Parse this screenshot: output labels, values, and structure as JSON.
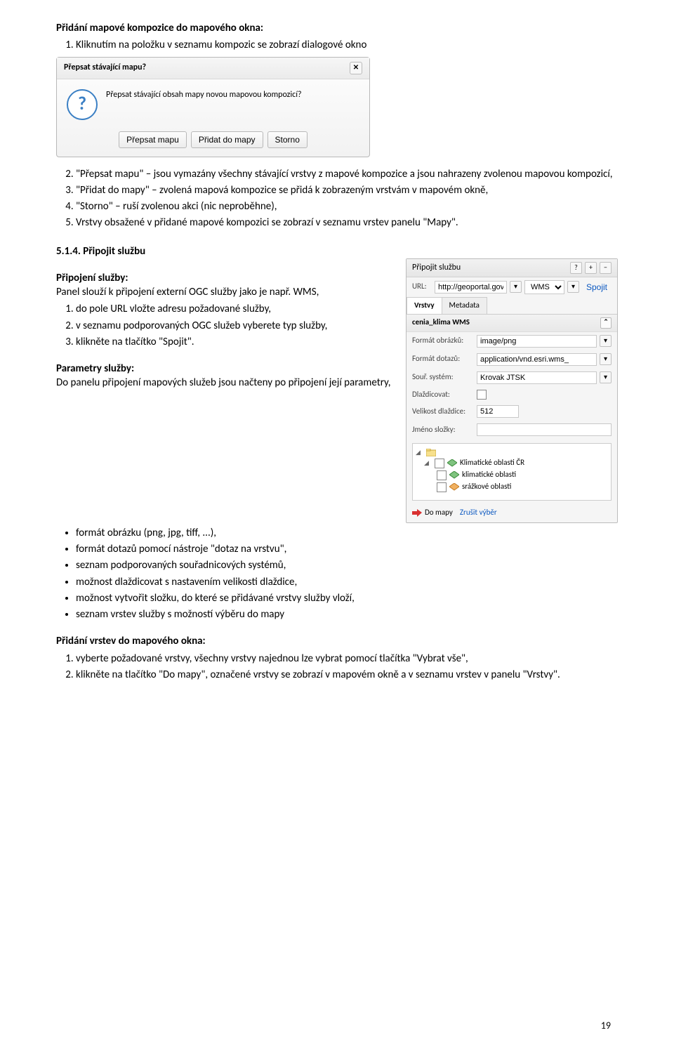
{
  "heading1": "Přidání mapové kompozice do mapového okna:",
  "list1": {
    "i1": "Kliknutím na položku v seznamu kompozic se zobrazí dialogové okno"
  },
  "dialog1": {
    "title": "Přepsat stávající mapu?",
    "question": "Přepsat stávající obsah mapy novou mapovou kompozicí?",
    "btn1": "Přepsat mapu",
    "btn2": "Přidat do mapy",
    "btn3": "Storno",
    "close": "✕"
  },
  "list2": {
    "i2": "\"Přepsat mapu\" – jsou vymazány všechny stávající vrstvy z mapové kompozice a jsou nahrazeny zvolenou mapovou kompozicí,",
    "i3": "\"Přidat do mapy\" – zvolená mapová kompozice se přidá k zobrazeným vrstvám v mapovém okně,",
    "i4": "\"Storno\" – ruší zvolenou akci (nic neproběhne),",
    "i5": "Vrstvy obsažené v přidané mapové kompozici se zobrazí v seznamu vrstev panelu \"Mapy\"."
  },
  "section514": {
    "title": "5.1.4. Připojit službu",
    "sub1": "Připojení služby:",
    "para1": "Panel slouží k připojení externí OGC služby jako je např. WMS,",
    "ol": {
      "a": "do pole URL vložte adresu požadované služby,",
      "b": "v seznamu podporovaných OGC služeb vyberete typ služby,",
      "c": "klikněte na tlačítko \"Spojit\"."
    },
    "sub2": "Parametry služby:",
    "para2": "Do panelu připojení mapových služeb jsou načteny po připojení její parametry,",
    "ul": {
      "a": "formát obrázku (png, jpg, tiff, ...),",
      "b": "formát dotazů pomocí nástroje \"dotaz na vrstvu\",",
      "c": "seznam podporovaných souřadnicových systémů,",
      "d": "možnost dlaždicovat s nastavením velikosti dlaždice,",
      "e": "možnost vytvořit složku, do které se přidávané vrstvy služby vloží,",
      "f": "seznam vrstev služby s možností výběru do mapy"
    }
  },
  "section_add": {
    "title": "Přidání vrstev do mapového okna:",
    "ol": {
      "a": "vyberte požadované vrstvy, všechny vrstvy najednou lze vybrat pomocí tlačítka \"Vybrat vše\",",
      "b": "klikněte na tlačítko \"Do mapy\", označené vrstvy se zobrazí v mapovém okně a v seznamu vrstev v panelu \"Vrstvy\"."
    }
  },
  "panel": {
    "title": "Připojit službu",
    "url_label": "URL:",
    "url_value": "http://geoportal.gov.cz/ArcGIS/s",
    "svc_type": "WMS",
    "connect": "Spojit",
    "tab_vrstvy": "Vrstvy",
    "tab_metadata": "Metadata",
    "service_name": "cenia_klima WMS",
    "rows": {
      "fmt_obr_l": "Formát obrázků:",
      "fmt_obr_v": "image/png",
      "fmt_dot_l": "Formát dotazů:",
      "fmt_dot_v": "application/vnd.esri.wms_",
      "sour_l": "Souř. systém:",
      "sour_v": "Krovak JTSK",
      "dlaz_l": "Dlaždicovat:",
      "vel_l": "Velikost dlaždice:",
      "vel_v": "512",
      "jmeno_l": "Jméno složky:"
    },
    "tree": {
      "root": "Klimatické oblasti ČR",
      "c1": "klimatické oblasti",
      "c2": "srážkové oblasti"
    },
    "footer": {
      "domapy": "Do mapy",
      "zrusit": "Zrušit výběr"
    }
  },
  "page_number": "19"
}
